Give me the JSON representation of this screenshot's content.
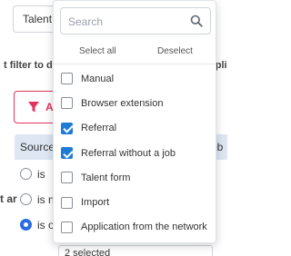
{
  "background": {
    "select_value": "Talent c",
    "filter_text": "t filter to def",
    "filter_text_right": "opli",
    "add_button_label": "A",
    "header_label": "Source i",
    "header_right_label": "ob",
    "side_text": "t ar",
    "radio_options": [
      {
        "label": "is",
        "selected": false
      },
      {
        "label": "is no",
        "selected": false
      },
      {
        "label": "is on",
        "selected": true
      }
    ],
    "bottom_select_value": "2 selected"
  },
  "dropdown": {
    "search_placeholder": "Search",
    "search_value": "",
    "select_all_label": "Select all",
    "deselect_label": "Deselect",
    "options": [
      {
        "label": "Manual",
        "checked": false
      },
      {
        "label": "Browser extension",
        "checked": false
      },
      {
        "label": "Referral",
        "checked": true
      },
      {
        "label": "Referral without a job",
        "checked": true
      },
      {
        "label": "Talent form",
        "checked": false
      },
      {
        "label": "Import",
        "checked": false
      },
      {
        "label": "Application from the network",
        "checked": false
      }
    ]
  },
  "colors": {
    "accent": "#1f7bd8",
    "brand": "#e4335f",
    "header_bg": "#dde6f2"
  }
}
